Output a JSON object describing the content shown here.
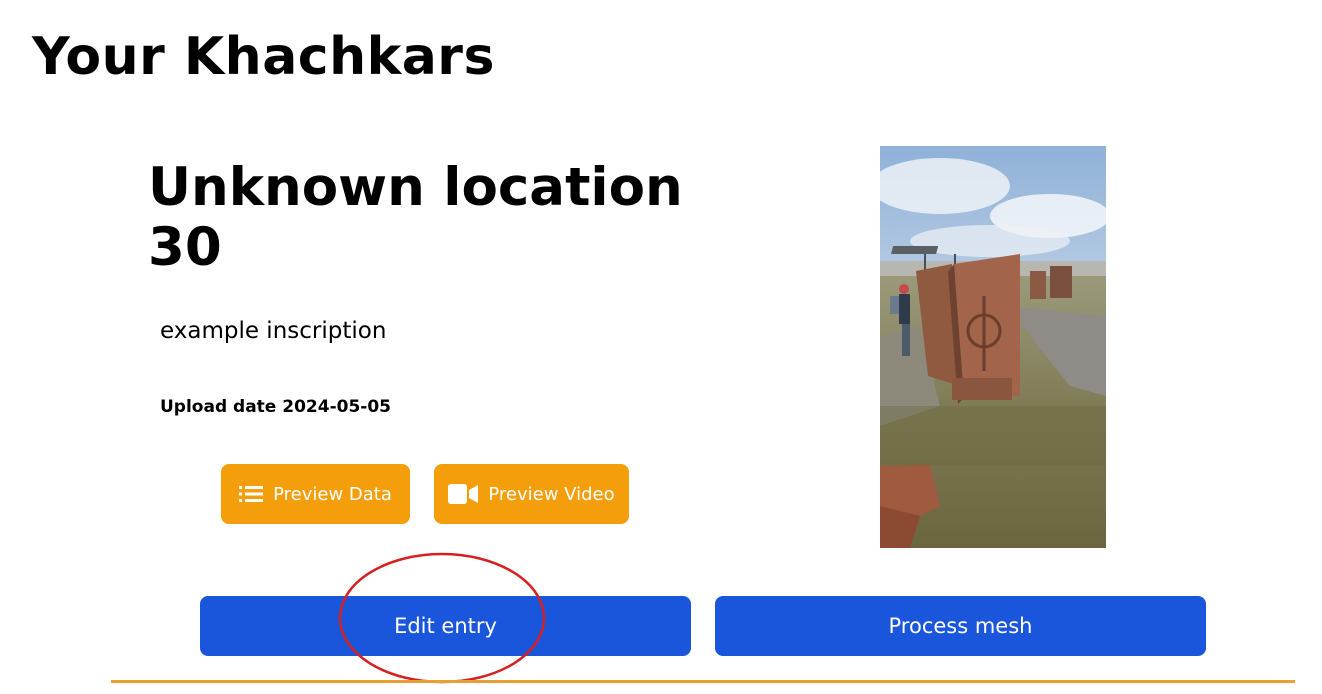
{
  "page": {
    "title": "Your Khachkars"
  },
  "entry": {
    "title": "Unknown location 30",
    "inscription": "example inscription",
    "upload_date_label": "Upload date 2024-05-05",
    "photo_icon": "khachkar-photo"
  },
  "actions": {
    "preview_data_label": "Preview Data",
    "preview_data_icon": "list-icon",
    "preview_video_label": "Preview Video",
    "preview_video_icon": "video-camera-icon",
    "edit_label": "Edit entry",
    "process_label": "Process mesh"
  },
  "colors": {
    "orange_button": "#f59e0b",
    "blue_button": "#1a56db",
    "divider": "#e8a033",
    "annotation_circle": "#d62020"
  }
}
